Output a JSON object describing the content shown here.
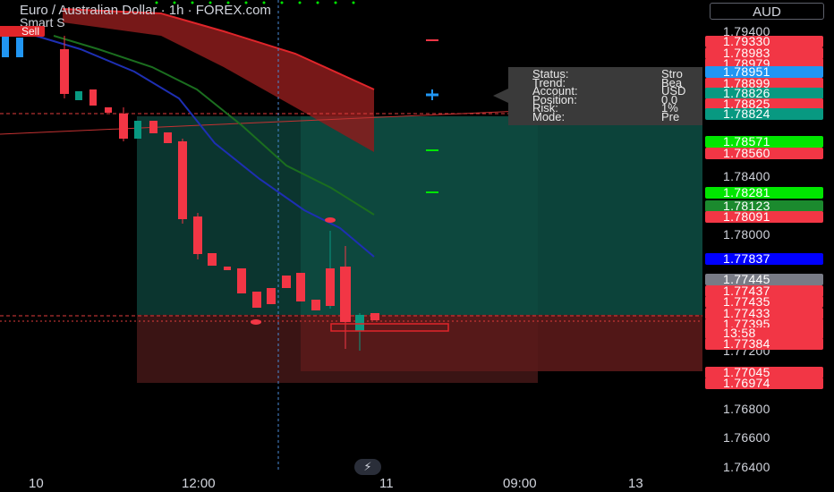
{
  "header": {
    "title": "Euro / Australian Dollar · 1h · FOREX.com",
    "indicator": "Smart S",
    "signal": "Sell"
  },
  "info_panel": {
    "rows": [
      {
        "key": "Status:",
        "value": "Stro"
      },
      {
        "key": "Trend:",
        "value": "Bea"
      },
      {
        "key": "Account:",
        "value": "USD"
      },
      {
        "key": "Position:",
        "value": "0.0"
      },
      {
        "key": "Risk:",
        "value": "1%"
      },
      {
        "key": "Mode:",
        "value": "Pre"
      }
    ]
  },
  "price_axis": {
    "currency": "AUD",
    "ticks": [
      "1.79400",
      "1.78400",
      "1.78000",
      "1.77200",
      "1.76800",
      "1.76600",
      "1.76400"
    ],
    "labels": [
      {
        "text": "1.79330",
        "color": "#f23645"
      },
      {
        "text": "1.78983",
        "color": "#f23645"
      },
      {
        "text": "1.78979",
        "color": "#f23645"
      },
      {
        "text": "1.78951",
        "color": "#2196f3"
      },
      {
        "text": "1.78899",
        "color": "#f23645"
      },
      {
        "text": "1.78826",
        "color": "#089981"
      },
      {
        "text": "1.78825",
        "color": "#f23645"
      },
      {
        "text": "1.78824",
        "color": "#089981"
      },
      {
        "text": "1.78571",
        "color": "#00e600"
      },
      {
        "text": "1.78560",
        "color": "#f23645"
      },
      {
        "text": "1.78281",
        "color": "#00e600"
      },
      {
        "text": "1.78123",
        "color": "#1b8a2e"
      },
      {
        "text": "1.78091",
        "color": "#f23645"
      },
      {
        "text": "1.77837",
        "color": "#0000ff"
      },
      {
        "text": "1.77445",
        "color": "#787b86"
      },
      {
        "text": "1.77437",
        "color": "#f23645"
      },
      {
        "text": "1.77435",
        "color": "#f23645"
      },
      {
        "text": "1.77433",
        "color": "#f23645"
      },
      {
        "text": "1.77395",
        "color": "#f23645"
      },
      {
        "text": "13:58",
        "color": "#f23645"
      },
      {
        "text": "1.77384",
        "color": "#f23645"
      },
      {
        "text": "1.77045",
        "color": "#f23645"
      },
      {
        "text": "1.76974",
        "color": "#f23645"
      }
    ]
  },
  "time_axis": {
    "ticks": [
      "10",
      "12:00",
      "11",
      "09:00",
      "13"
    ]
  },
  "colors": {
    "bull": "#f23645",
    "bear": "#f23645",
    "tp_zone": "#0c3b34",
    "sl_zone": "#3b1414",
    "ema_fast": "#1e2fb3",
    "ema_slow": "#1b6e1f"
  },
  "icons": {
    "flash": "lightning-icon"
  }
}
